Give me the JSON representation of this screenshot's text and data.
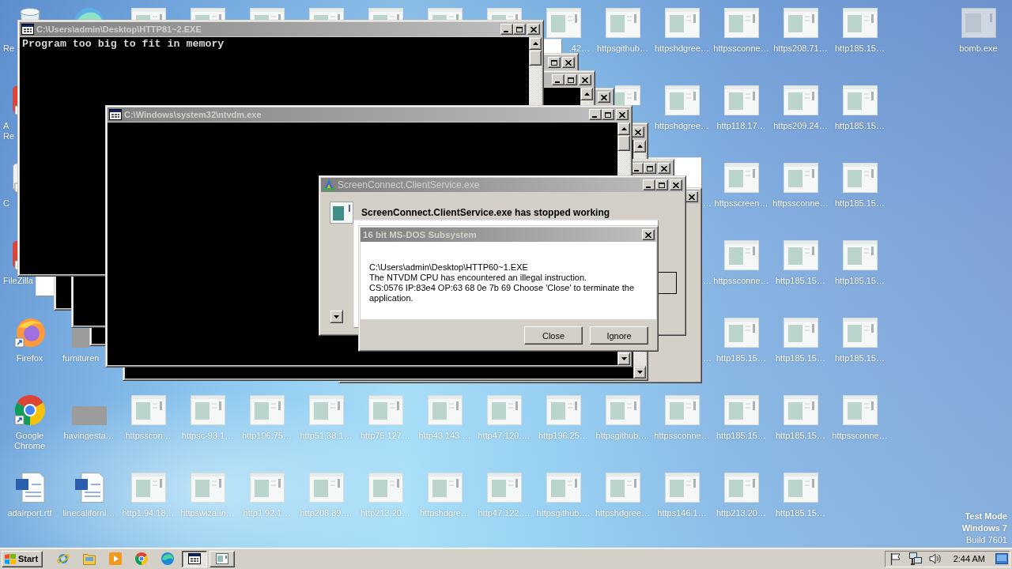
{
  "desktop": {
    "rows": [
      [
        {
          "kind": "recycle-bin",
          "label": "Re"
        },
        {
          "kind": "swirl"
        },
        {
          "kind": "file"
        },
        {
          "kind": "file"
        },
        {
          "kind": "file"
        },
        {
          "kind": "file"
        },
        {
          "kind": "file"
        },
        {
          "kind": "file"
        },
        {
          "kind": "file"
        },
        {
          "kind": "file",
          "label": ".42…"
        },
        {
          "kind": "file",
          "label": "httpsgithub…"
        },
        {
          "kind": "file",
          "label": "httpshdgree…"
        },
        {
          "kind": "file",
          "label": "httpssconne…"
        },
        {
          "kind": "file",
          "label": "https208.71…"
        },
        {
          "kind": "file",
          "label": "http185.15…"
        },
        null,
        {
          "kind": "program",
          "label": "bomb.exe"
        }
      ],
      [
        {
          "kind": "red-shortcut",
          "label": "A Re"
        },
        null,
        null,
        null,
        null,
        null,
        null,
        null,
        null,
        null,
        {
          "kind": "file"
        },
        {
          "kind": "file",
          "label": "httpshdgree…"
        },
        {
          "kind": "file",
          "label": "http118.17…"
        },
        {
          "kind": "file",
          "label": "https209.24…"
        },
        {
          "kind": "file",
          "label": "http185.15…"
        }
      ],
      [
        {
          "kind": "app-shortcut",
          "label": "C"
        },
        null,
        null,
        null,
        null,
        null,
        null,
        null,
        null,
        null,
        null,
        {
          "label": "…"
        },
        {
          "kind": "file",
          "label": "httpsscreen…"
        },
        {
          "kind": "file",
          "label": "httpssconne…"
        },
        {
          "kind": "file",
          "label": "http185.15…"
        }
      ],
      [
        {
          "kind": "red-shortcut",
          "label": "FileZilla"
        },
        null,
        null,
        null,
        null,
        null,
        null,
        null,
        null,
        null,
        null,
        {
          "label": "…"
        },
        {
          "kind": "file",
          "label": "httpssconne…"
        },
        {
          "kind": "file",
          "label": "http185.15…"
        },
        {
          "kind": "file",
          "label": "http185.15…"
        }
      ],
      [
        {
          "kind": "firefox",
          "label": "Firefox"
        },
        {
          "kind": "blank",
          "label": "furnituren"
        },
        null,
        null,
        null,
        null,
        null,
        null,
        null,
        null,
        null,
        {
          "label": "…"
        },
        {
          "kind": "file",
          "label": "http185.15…"
        },
        {
          "kind": "file",
          "label": "http185.15…"
        },
        {
          "kind": "file",
          "label": "http185.15…"
        }
      ],
      [
        {
          "kind": "chrome",
          "label": "Google Chrome"
        },
        {
          "kind": "blank",
          "label": "havingesta…"
        },
        {
          "kind": "file",
          "label": "httpsscon…"
        },
        {
          "kind": "file",
          "label": "httpsc-93.1…"
        },
        {
          "kind": "file",
          "label": "http106.75…"
        },
        {
          "kind": "file",
          "label": "http51.38.1…"
        },
        {
          "kind": "file",
          "label": "http75.127…"
        },
        {
          "kind": "file",
          "label": "http43.143.…"
        },
        {
          "kind": "file",
          "label": "http47.120.…"
        },
        {
          "kind": "file",
          "label": "http196.25…"
        },
        {
          "kind": "file",
          "label": "httpsgithub.…"
        },
        {
          "kind": "file",
          "label": "httpssconne…"
        },
        {
          "kind": "file",
          "label": "http185.15…"
        },
        {
          "kind": "file",
          "label": "http185.15…"
        },
        {
          "kind": "file",
          "label": "httpssconne…"
        }
      ],
      [
        {
          "kind": "word-document",
          "label": "adairport.rtf"
        },
        {
          "kind": "word-document",
          "label": "linecaliforni…"
        },
        {
          "kind": "file",
          "label": "http1.94.18…"
        },
        {
          "kind": "file",
          "label": "httpswiza.in…"
        },
        {
          "kind": "file",
          "label": "http1.92.1…"
        },
        {
          "kind": "file",
          "label": "http208.89.…"
        },
        {
          "kind": "file",
          "label": "http213.20…"
        },
        {
          "kind": "file",
          "label": "httpshdgre…"
        },
        {
          "kind": "file",
          "label": "http47.122.…"
        },
        {
          "kind": "file",
          "label": "httpsgithub.…"
        },
        {
          "kind": "file",
          "label": "httpshdgree…"
        },
        {
          "kind": "file",
          "label": "https146.1…"
        },
        {
          "kind": "file",
          "label": "http213.20…"
        },
        {
          "kind": "file",
          "label": "http185.15…"
        }
      ]
    ]
  },
  "windows": [
    {
      "kind": "console",
      "controls": [
        {
          "kind": "close"
        }
      ]
    },
    {
      "kind": "blank"
    },
    {
      "kind": "console",
      "controls": [
        {
          "kind": "maximize"
        },
        {
          "kind": "close"
        }
      ]
    },
    {
      "kind": "console",
      "controls": [
        {
          "kind": "minimize"
        },
        {
          "kind": "maximize"
        },
        {
          "kind": "close"
        }
      ]
    },
    {
      "kind": "console",
      "title": "C:\\Users\\admin\\Desktop\\HTTP81~2.EXE",
      "controls": [
        {
          "kind": "minimize"
        },
        {
          "kind": "maximize"
        },
        {
          "kind": "close"
        }
      ],
      "lines": [
        "Program too big to fit in memory"
      ]
    },
    {
      "kind": "blank"
    },
    {
      "kind": "panel",
      "controls": [
        {
          "kind": "close"
        }
      ]
    },
    {
      "kind": "console",
      "controls": [
        {
          "kind": "close"
        }
      ]
    },
    {
      "kind": "panel",
      "controls": [
        {
          "kind": "minimize"
        },
        {
          "kind": "maximize"
        },
        {
          "kind": "close"
        }
      ]
    },
    {
      "kind": "console",
      "title": "C:\\Windows\\system32\\ntvdm.exe",
      "controls": [
        {
          "kind": "minimize"
        },
        {
          "kind": "maximize"
        },
        {
          "kind": "close"
        }
      ]
    },
    {
      "kind": "error-report",
      "title": "ScreenConnect.ClientService.exe",
      "controls": [
        {
          "kind": "minimize"
        },
        {
          "kind": "maximize"
        },
        {
          "kind": "close"
        }
      ],
      "heading": "ScreenConnect.ClientService.exe has stopped working"
    },
    {
      "kind": "blank"
    },
    {
      "kind": "message",
      "title": "16 bit MS-DOS Subsystem",
      "controls": [
        {
          "kind": "close"
        }
      ],
      "message": [
        "C:\\Users\\admin\\Desktop\\HTTP60~1.EXE",
        "The NTVDM CPU has encountered an illegal instruction.",
        "CS:0576 IP:83e4 OP:63 68 0e 7b 69 Choose 'Close' to terminate the application."
      ],
      "buttons": [
        "Close",
        "Ignore"
      ]
    }
  ],
  "os_notice": [
    "Test Mode",
    "Windows 7",
    "Build 7601"
  ],
  "taskbar": {
    "start_label": "Start",
    "quick_launch": [
      {
        "kind": "ie"
      },
      {
        "kind": "folder"
      },
      {
        "kind": "media"
      },
      {
        "kind": "chrome"
      },
      {
        "kind": "edge"
      }
    ],
    "tasks": [
      {
        "kind": "console",
        "selected": true
      },
      {
        "kind": "window",
        "selected": false
      }
    ],
    "tray_icons": [
      {
        "kind": "flag"
      },
      {
        "kind": "network"
      },
      {
        "kind": "speaker"
      }
    ],
    "clock": "2:44 AM"
  }
}
